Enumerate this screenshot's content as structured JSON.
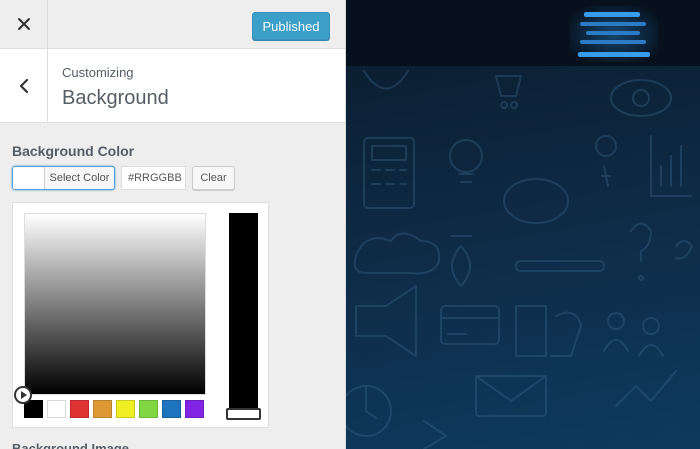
{
  "header": {
    "publish_label": "Published"
  },
  "section": {
    "breadcrumb": "Customizing",
    "title": "Background"
  },
  "control": {
    "title": "Background Color",
    "select_color_label": "Select Color",
    "current_color": "#ffffff",
    "hex_placeholder": "#RRGGBB",
    "clear_label": "Clear",
    "palette": [
      "#000000",
      "#ffffff",
      "#dd3333",
      "#dd9933",
      "#eeee22",
      "#81d742",
      "#1e73be",
      "#8224e3"
    ]
  },
  "next_control": {
    "title": "Background Image"
  },
  "icons": [
    "close-icon",
    "chevron-left-icon",
    "picker-handle-icon"
  ],
  "colors": {
    "accent": "#0085ba",
    "panel_bg": "#eeeeee",
    "preview_bg": "#0e2c48"
  }
}
